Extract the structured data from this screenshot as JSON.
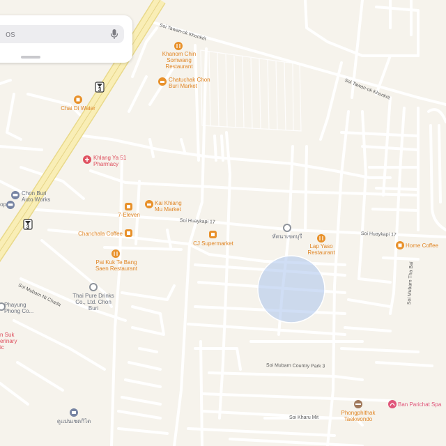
{
  "search": {
    "text": "os"
  },
  "icons": {
    "mic": "mic-icon",
    "highway_shield": "highway-shield-icon"
  },
  "colors": {
    "map_bg": "#f6f3ec",
    "road": "#ffffff",
    "highway": "#f7e8a3",
    "poi_orange": "#e8912b",
    "poi_red": "#e05261",
    "poi_gray": "#8e939b",
    "location_circle": "#aac3ec"
  },
  "highway": {
    "number": "3"
  },
  "streets": {
    "s1": "Soi Tawan-ok Khonkrit",
    "s2": "Soi Tawan-ok Khonkrit",
    "s3": "Soi Huaykapi 17",
    "s4": "Soi Huaykapi 17",
    "s5": "Soi Mubarn Ni Chada",
    "s6": "Soi Mubarn Tha Bai",
    "s7": "Soi Mubarn Country Park 3",
    "s8": "Soi Kharu Mit"
  },
  "pois": {
    "khanom": "Khanom Chin Somwang Restaurant",
    "chatuchak": "Chatuchak Chon Buri Market",
    "chaidi": "Chai Di Water",
    "khlangya": "Khlang Ya 51 Pharmacy",
    "chonburi_auto": "Chon Buri Auto Works",
    "edge_op": "op",
    "seven": "7-Eleven",
    "kaikhiang": "Kai Khiang Mu Market",
    "chanchala": "Chanchala Coffee",
    "cj": "CJ Supermarket",
    "thai_landmark": "หัดนาเขตบุรี",
    "lapyaso": "Lap Yaso Restaurant",
    "homecoffee": "Home Coffee",
    "paikuk": "Pai Kuk Te Bang Saen Restaurant",
    "thaipure": "Thai Pure Drinks Co., Ltd. Chon Buri",
    "phayung": "Phayung Phong Co...",
    "nsuk": "n Suk erinary ic",
    "phongphithak": "Phongphithak Taekwondo",
    "banparichat": "Ban Parichat Spa",
    "thai_bottom": "ดูแม่นเชดกิไต"
  }
}
